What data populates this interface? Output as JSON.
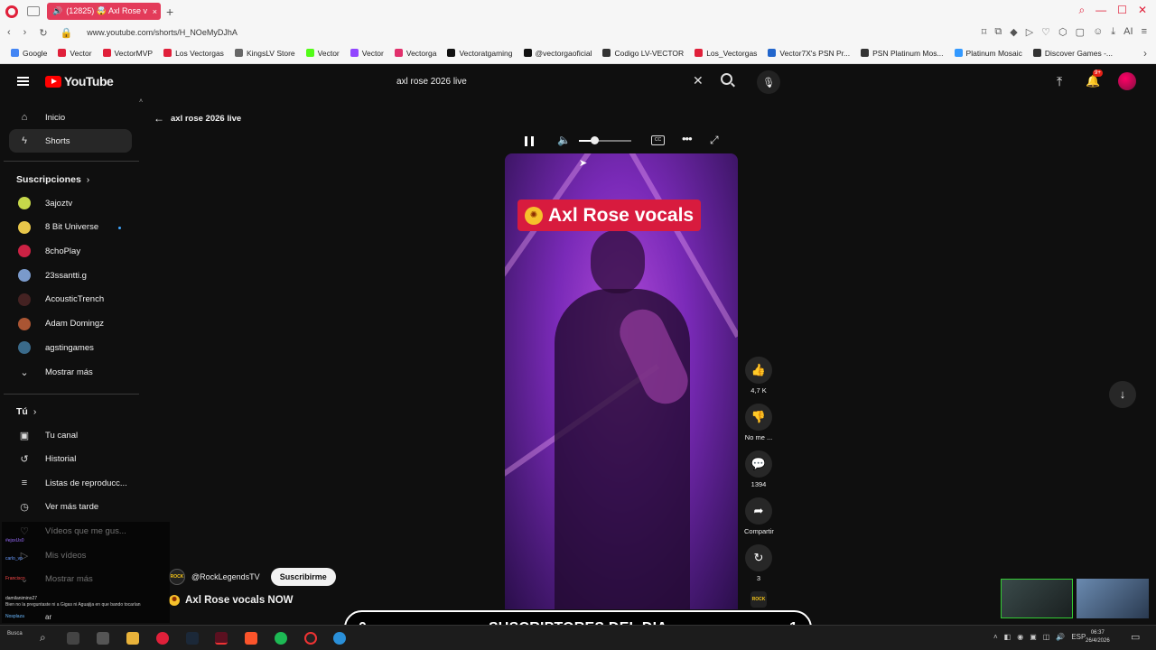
{
  "browser": {
    "tab_title": "(12825) 🤯 Axl Rose v",
    "url": "www.youtube.com/shorts/H_NOeMyDJhA",
    "bookmarks": [
      {
        "label": "Google",
        "color": "#4285f4"
      },
      {
        "label": "Vector",
        "color": "#e0203a"
      },
      {
        "label": "VectorMVP",
        "color": "#e0203a"
      },
      {
        "label": "Los Vectorgas",
        "color": "#e0203a"
      },
      {
        "label": "KingsLV Store",
        "color": "#666666"
      },
      {
        "label": "Vector",
        "color": "#53fc18"
      },
      {
        "label": "Vector",
        "color": "#9146ff"
      },
      {
        "label": "Vectorga",
        "color": "#e1306c"
      },
      {
        "label": "Vectoratgaming",
        "color": "#111111"
      },
      {
        "label": "@vectorgaoficial",
        "color": "#111111"
      },
      {
        "label": "Codigo LV-VECTOR",
        "color": "#333333"
      },
      {
        "label": "Los_Vectorgas",
        "color": "#e0203a"
      },
      {
        "label": "Vector7X's PSN Pr...",
        "color": "#2266cc"
      },
      {
        "label": "PSN Platinum Mos...",
        "color": "#333333"
      },
      {
        "label": "Platinum Mosaic",
        "color": "#3399ff"
      },
      {
        "label": "Discover Games -...",
        "color": "#333333"
      }
    ]
  },
  "youtube": {
    "logo_text": "YouTube",
    "search_value": "axl rose 2026 live",
    "notif_badge": "9+",
    "back_label": "axl rose 2026 live"
  },
  "sidebar": {
    "main": [
      {
        "label": "Inicio",
        "icon": "home-icon",
        "glyph": "⌂"
      },
      {
        "label": "Shorts",
        "icon": "shorts-icon",
        "glyph": "ϟ"
      }
    ],
    "subs_heading": "Suscripciones",
    "subs": [
      {
        "label": "3ajoztv",
        "color": "#c6d84a"
      },
      {
        "label": "8 Bit Universe",
        "color": "#e8c64a"
      },
      {
        "label": "8choPlay",
        "color": "#cc2244"
      },
      {
        "label": "23ssantti.g",
        "color": "#7a9acb"
      },
      {
        "label": "AcousticTrench",
        "color": "#442222"
      },
      {
        "label": "Adam Domingz",
        "color": "#aa5533"
      },
      {
        "label": "agstingames",
        "color": "#3a6a8a"
      }
    ],
    "show_more": "Mostrar más",
    "you_heading": "Tú",
    "you": [
      {
        "label": "Tu canal",
        "glyph": "▣"
      },
      {
        "label": "Historial",
        "glyph": "↺"
      },
      {
        "label": "Listas de reproducc...",
        "glyph": "≡"
      },
      {
        "label": "Ver más tarde",
        "glyph": "◷"
      },
      {
        "label": "Vídeos que me gus...",
        "glyph": "♡"
      },
      {
        "label": "Mis vídeos",
        "glyph": "▷"
      },
      {
        "label": "Mostrar más",
        "glyph": "⌄"
      }
    ]
  },
  "video": {
    "caption": "Axl Rose vocals",
    "channel": "@RockLegendsTV",
    "channel_avatar_text": "ROCK",
    "subscribe": "Suscribirme",
    "title": "Axl Rose vocals NOW",
    "volume_fraction": 0.3
  },
  "actions": {
    "likes": "4,7 K",
    "dislike": "No me ...",
    "comments": "1394",
    "share": "Compartir",
    "remix": "3"
  },
  "overlay": {
    "left_count": "0",
    "title": "SUSCRIPTORES DEL DIA",
    "right_count": "1"
  },
  "chat": [
    {
      "user": "#ejsxUs0",
      "text": ""
    },
    {
      "user": "carlo_vp",
      "text": ""
    },
    {
      "user": "Francisco",
      "text": ""
    },
    {
      "user": "damilanimino27",
      "text": ""
    },
    {
      "user": "",
      "text": "Bien no la preguntaste ni a Gigas ni Aguajija en que bando tocarían"
    },
    {
      "user": "Nosplaza",
      "text": "ar"
    }
  ],
  "taskbar": {
    "search_placeholder": "Busca",
    "lang": "ESP",
    "time": "06:37",
    "date": "26/4/2026"
  }
}
